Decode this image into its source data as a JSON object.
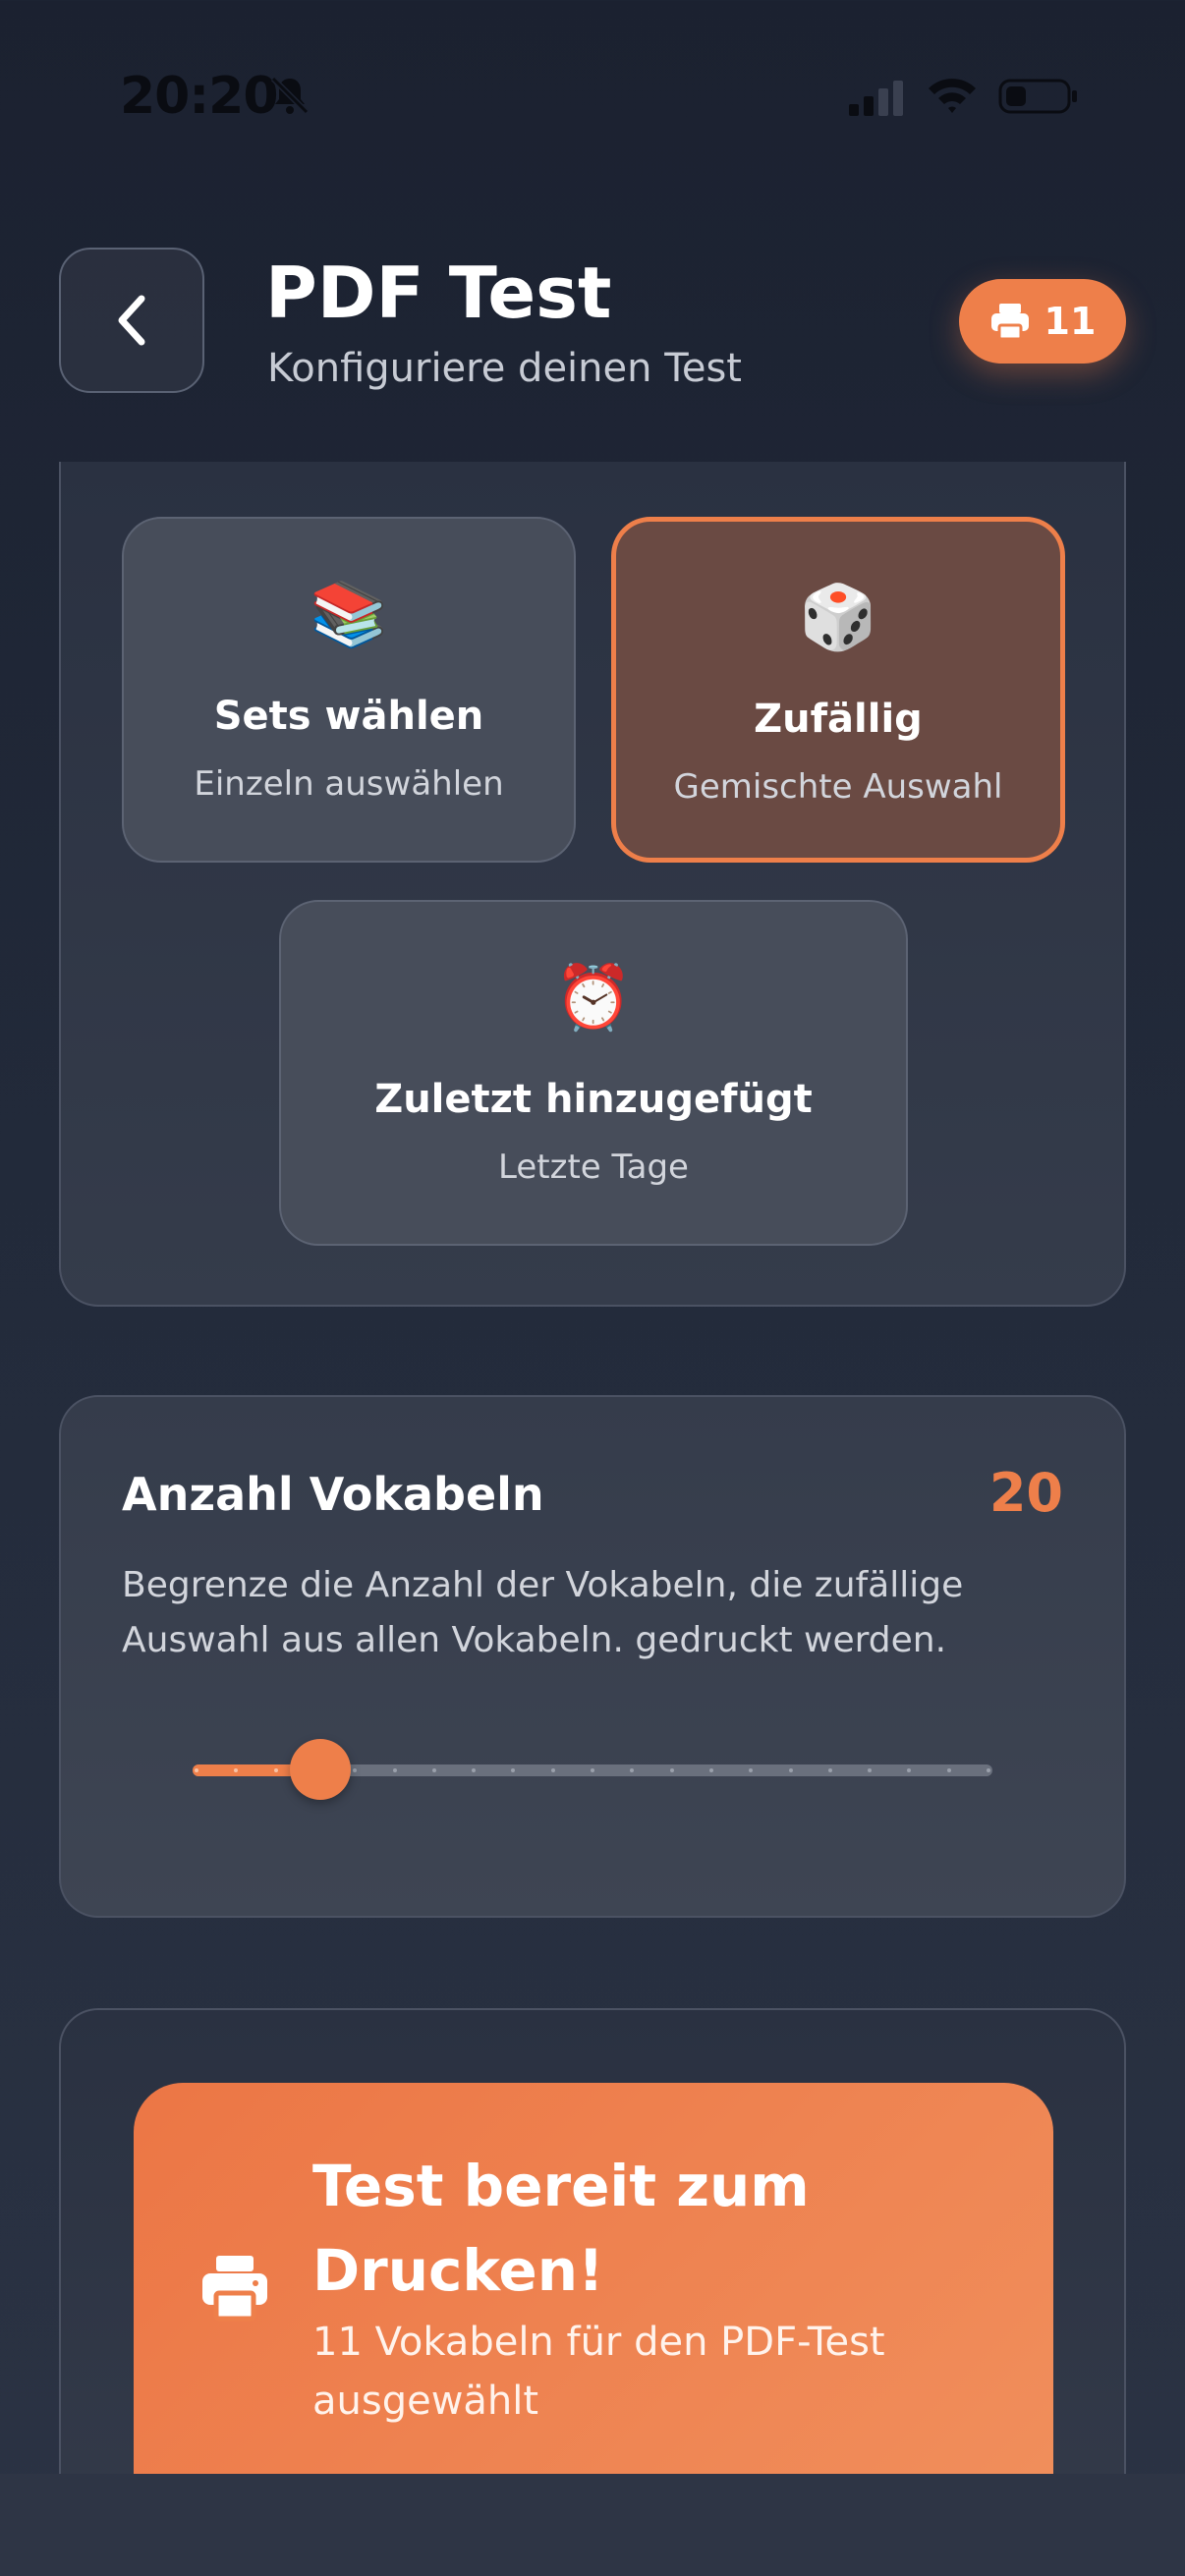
{
  "status_bar": {
    "time": "20:20",
    "icons": [
      "bell-slash-icon",
      "signal-icon",
      "wifi-icon",
      "battery-icon"
    ]
  },
  "header": {
    "back_icon": "chevron-left-icon",
    "title": "PDF Test",
    "subtitle": "Konfiguriere deinen Test",
    "print_badge": {
      "icon": "printer-icon",
      "count": "11"
    }
  },
  "selection_mode": {
    "options": [
      {
        "emoji": "📚",
        "title": "Sets wählen",
        "subtitle": "Einzeln auswählen",
        "selected": false
      },
      {
        "emoji": "🎲",
        "title": "Zufällig",
        "subtitle": "Gemischte Auswahl",
        "selected": true
      },
      {
        "emoji": "⏰",
        "title": "Zuletzt hinzugefügt",
        "subtitle": "Letzte Tage",
        "selected": false
      }
    ]
  },
  "vocab_count": {
    "title": "Anzahl Vokabeln",
    "value": "20",
    "description": "Begrenze die Anzahl der Vokabeln, die zufällige Auswahl aus allen Vokabeln. gedruckt werden.",
    "slider": {
      "value_fraction": 0.16,
      "steps": 20
    }
  },
  "ready": {
    "icon": "printer-icon",
    "title": "Test bereit zum Drucken!",
    "subtitle": "11 Vokabeln für den PDF-Test ausgewählt"
  },
  "colors": {
    "accent": "#ee7f4a",
    "background": "#1b2130",
    "selected_card": "#6a4a43"
  }
}
